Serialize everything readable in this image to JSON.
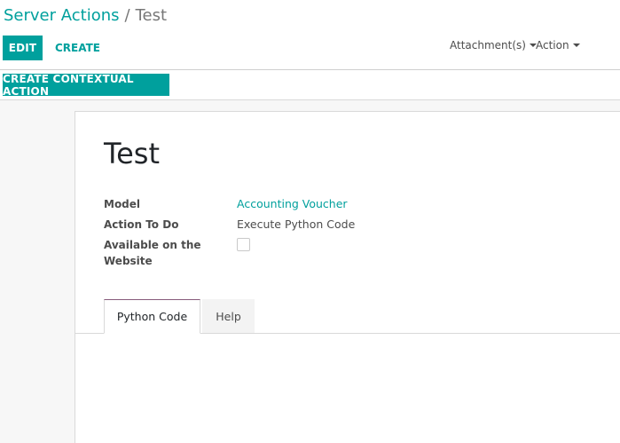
{
  "breadcrumb": {
    "parent": "Server Actions",
    "separator": "/",
    "current": "Test"
  },
  "buttons": {
    "edit": "EDIT",
    "create": "CREATE",
    "create_contextual_action": "CREATE CONTEXTUAL ACTION"
  },
  "dropdowns": {
    "attachments": "Attachment(s)",
    "action": "Action"
  },
  "form": {
    "title": "Test",
    "fields": {
      "model_label": "Model",
      "model_value": "Accounting Voucher",
      "action_label": "Action To Do",
      "action_value": "Execute Python Code",
      "website_label": "Available on the Website",
      "website_checked": false
    }
  },
  "tabs": {
    "python_code": "Python Code",
    "help": "Help"
  },
  "colors": {
    "accent": "#00a09d",
    "tab_highlight": "#875a7b"
  }
}
